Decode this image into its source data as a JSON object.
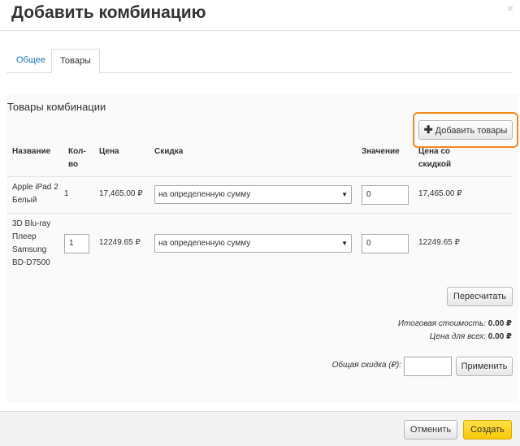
{
  "dialog": {
    "title": "Добавить комбинацию",
    "close_glyph": "×"
  },
  "tabs": [
    {
      "label": "Общее",
      "active": false
    },
    {
      "label": "Товары",
      "active": true
    }
  ],
  "section": {
    "title": "Товары комбинации",
    "add_button_label": "Добавить товары",
    "add_button_icon": "plus-icon"
  },
  "table": {
    "headers": {
      "name": "Название",
      "qty": "Кол-во",
      "price": "Цена",
      "discount": "Скидка",
      "value": "Значение",
      "price_discount": "Цена со скидкой"
    },
    "rows": [
      {
        "name": "Apple iPad 2 Белый",
        "qty": "1",
        "price": "17,465.00 ₽",
        "discount": "на определенную сумму",
        "value": "0",
        "price_discount": "17,465.00 ₽"
      },
      {
        "name": "3D Blu-ray Плеер Samsung BD-D7500",
        "qty": "1",
        "price": "12249.65 ₽",
        "discount": "на определенную сумму",
        "value": "0",
        "price_discount": "12249.65 ₽"
      }
    ]
  },
  "recalc_button": "Пересчитать",
  "totals": {
    "total_label": "Итоговая стоимость:",
    "total_value": "0.00 ₽",
    "all_label": "Цена для всех:",
    "all_value": "0.00 ₽"
  },
  "common_discount": {
    "label": "Общая скидка (₽):",
    "value": "",
    "apply_button": "Применить"
  },
  "footer": {
    "cancel": "Отменить",
    "create": "Создать"
  },
  "colors": {
    "highlight": "#ef8a1e",
    "tab_link": "#1b76b2",
    "create_button": "#f7c900"
  }
}
